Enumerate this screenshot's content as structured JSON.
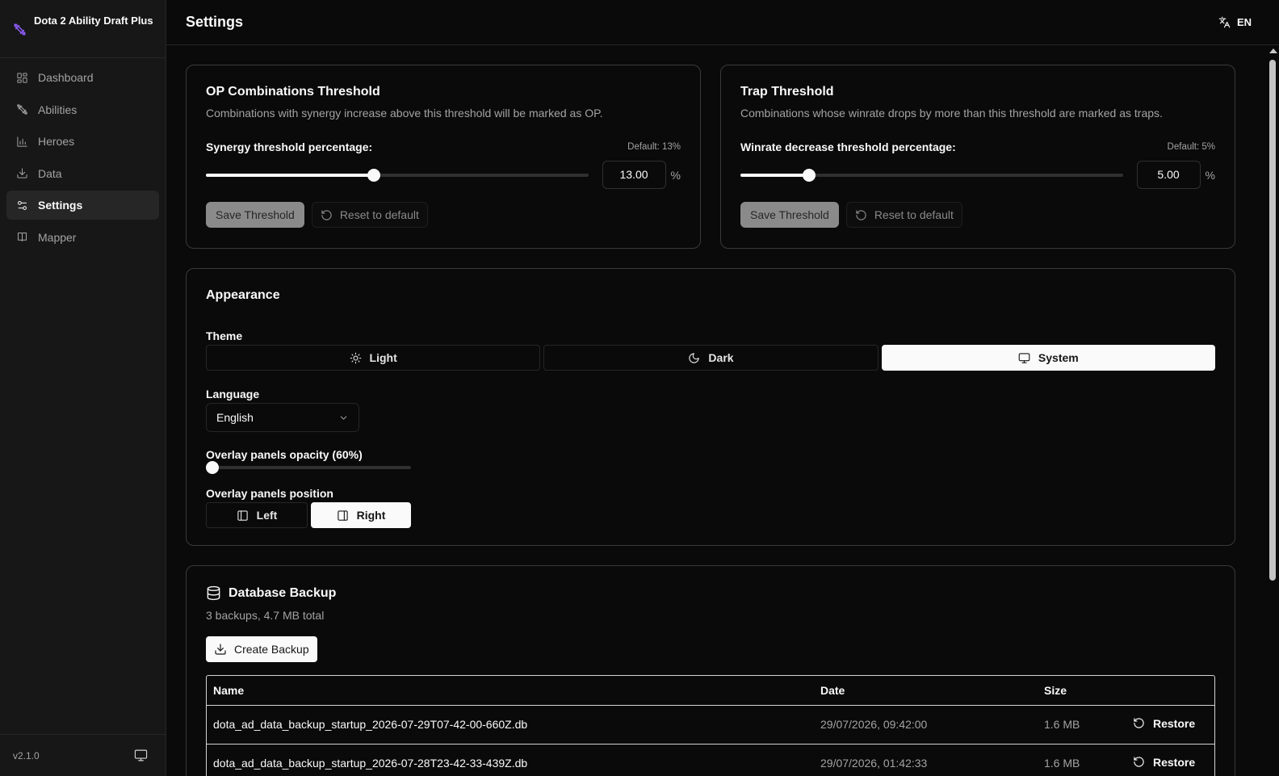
{
  "app": {
    "name": "Dota 2 Ability Draft Plus",
    "version": "v2.1.0"
  },
  "sidebar": {
    "items": [
      {
        "label": "Dashboard",
        "icon": "dashboard-icon"
      },
      {
        "label": "Abilities",
        "icon": "swords-icon"
      },
      {
        "label": "Heroes",
        "icon": "bar-chart-icon"
      },
      {
        "label": "Data",
        "icon": "download-icon"
      },
      {
        "label": "Settings",
        "icon": "settings-sliders-icon",
        "active": true
      },
      {
        "label": "Mapper",
        "icon": "map-icon"
      }
    ]
  },
  "header": {
    "title": "Settings",
    "language": "EN"
  },
  "op_threshold": {
    "title": "OP Combinations Threshold",
    "description": "Combinations with synergy increase above this threshold will be marked as OP.",
    "label": "Synergy threshold percentage:",
    "default_note": "Default: 13%",
    "value": "13.00",
    "slider_fraction": 0.44,
    "unit": "%",
    "save_label": "Save Threshold",
    "reset_label": "Reset to default"
  },
  "trap_threshold": {
    "title": "Trap Threshold",
    "description": "Combinations whose winrate drops by more than this threshold are marked as traps.",
    "label": "Winrate decrease threshold percentage:",
    "default_note": "Default: 5%",
    "value": "5.00",
    "slider_fraction": 0.18,
    "unit": "%",
    "save_label": "Save Threshold",
    "reset_label": "Reset to default"
  },
  "appearance": {
    "title": "Appearance",
    "theme_label": "Theme",
    "themes": {
      "light": "Light",
      "dark": "Dark",
      "system": "System"
    },
    "selected_theme": "System",
    "language_label": "Language",
    "language_value": "English",
    "opacity_label": "Overlay panels opacity (60%)",
    "opacity_fraction": 0.0,
    "position_label": "Overlay panels position",
    "positions": {
      "left": "Left",
      "right": "Right"
    },
    "selected_position": "Right"
  },
  "backup": {
    "title": "Database Backup",
    "summary": "3 backups, 4.7 MB total",
    "create_label": "Create Backup",
    "columns": {
      "name": "Name",
      "date": "Date",
      "size": "Size"
    },
    "restore_label": "Restore",
    "rows": [
      {
        "name": "dota_ad_data_backup_startup_2026-07-29T07-42-00-660Z.db",
        "date": "29/07/2026, 09:42:00",
        "size": "1.6 MB"
      },
      {
        "name": "dota_ad_data_backup_startup_2026-07-28T23-42-33-439Z.db",
        "date": "29/07/2026, 01:42:33",
        "size": "1.6 MB"
      }
    ]
  },
  "colors": {
    "background": "#0a0a0a",
    "sidebar": "#171717",
    "accent": "#8b5cf6",
    "border": "#3a3a3a"
  }
}
